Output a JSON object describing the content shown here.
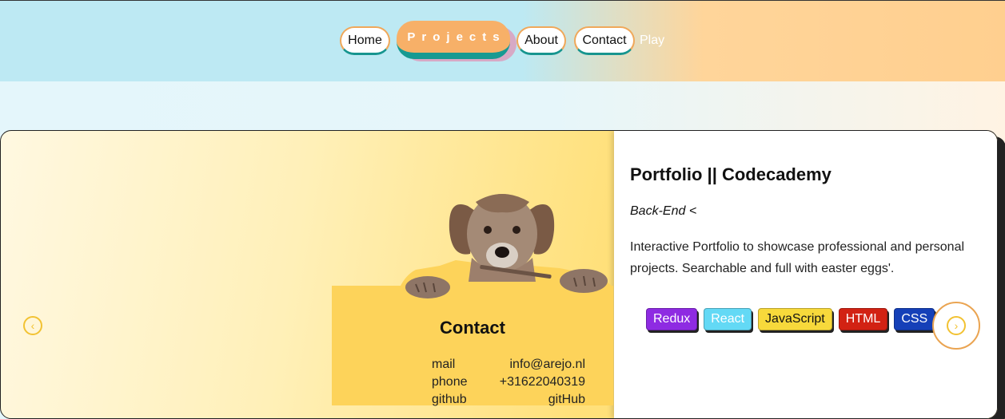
{
  "nav": {
    "items": [
      "Home",
      "About",
      "Contact"
    ],
    "active": "Projects",
    "play": "Play"
  },
  "project": {
    "title": "Portfolio || Codecademy",
    "subtitle": "Back-End <",
    "description": "Interactive Portfolio to showcase professional and personal projects. Searchable and full with easter eggs'.",
    "tags": [
      {
        "label": "Redux",
        "bg": "#8e2be2",
        "fg": "#ffffff"
      },
      {
        "label": "React",
        "bg": "#63d9f5",
        "fg": "#ffffff"
      },
      {
        "label": "JavaScript",
        "bg": "#f7d93b",
        "fg": "#111111"
      },
      {
        "label": "HTML",
        "bg": "#d22213",
        "fg": "#ffffff"
      },
      {
        "label": "CSS",
        "bg": "#1540b8",
        "fg": "#ffffff"
      }
    ]
  },
  "contact": {
    "title": "Contact",
    "rows": [
      {
        "label": "mail",
        "value": "info@arejo.nl"
      },
      {
        "label": "phone",
        "value": "+31622040319"
      },
      {
        "label": "github",
        "value": "gitHub"
      }
    ]
  },
  "icons": {
    "prev": "chevron-left-icon",
    "next": "chevron-right-icon"
  }
}
